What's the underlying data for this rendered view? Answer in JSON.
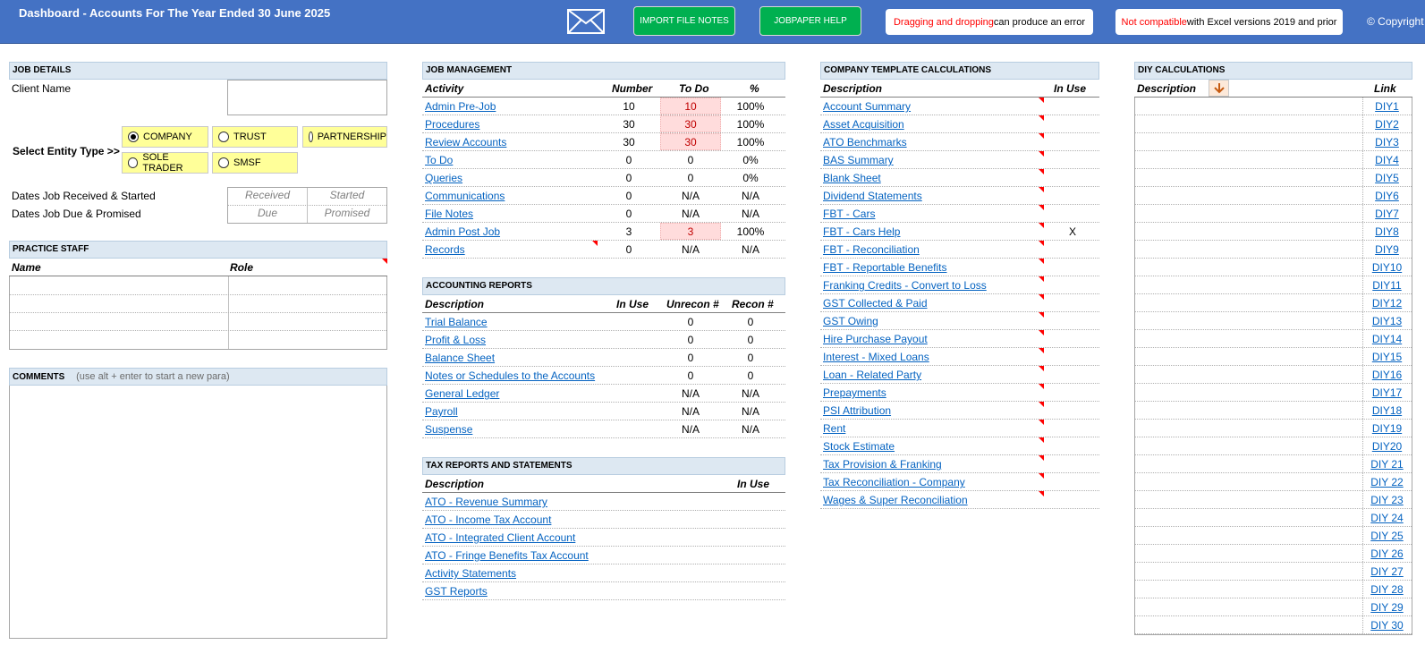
{
  "header": {
    "title": "Dashboard - Accounts For The Year Ended 30 June 2025",
    "import_button": "IMPORT FILE NOTES",
    "help_button": "JOBPAPER HELP",
    "notice1_red": "Dragging and dropping",
    "notice1_rest": " can produce an error",
    "notice2_red": "Not compatible",
    "notice2_rest": " with Excel versions 2019 and prior",
    "copyright": "© Copyright",
    "mail_icon": "envelope-icon"
  },
  "job_details": {
    "heading": "JOB DETAILS",
    "client_name_label": "Client Name",
    "client_name_value": "",
    "entity_label": "Select Entity Type >>",
    "entity_options": [
      "COMPANY",
      "TRUST",
      "PARTNERSHIP",
      "SOLE TRADER",
      "SMSF"
    ],
    "selected_entity": "COMPANY",
    "dates_received_label": "Dates Job Received & Started",
    "dates_due_label": "Dates Job Due & Promised",
    "received": "Received",
    "started": "Started",
    "due": "Due",
    "promised": "Promised"
  },
  "practice_staff": {
    "heading": "PRACTICE STAFF",
    "col_name": "Name",
    "col_role": "Role"
  },
  "comments": {
    "heading": "COMMENTS",
    "hint": "(use alt + enter to start a new para)",
    "value": ""
  },
  "job_management": {
    "heading": "JOB MANAGEMENT",
    "columns": [
      "Activity",
      "Number",
      "To Do",
      "%"
    ],
    "rows": [
      {
        "activity": "Admin Pre-Job",
        "number": "10",
        "todo": "10",
        "pct": "100%",
        "flag": true
      },
      {
        "activity": "Procedures",
        "number": "30",
        "todo": "30",
        "pct": "100%",
        "flag": true
      },
      {
        "activity": "Review Accounts",
        "number": "30",
        "todo": "30",
        "pct": "100%",
        "flag": true
      },
      {
        "activity": "To Do",
        "number": "0",
        "todo": "0",
        "pct": "0%",
        "flag": false
      },
      {
        "activity": "Queries",
        "number": "0",
        "todo": "0",
        "pct": "0%",
        "flag": false
      },
      {
        "activity": "Communications",
        "number": "0",
        "todo": "N/A",
        "pct": "N/A",
        "flag": false
      },
      {
        "activity": "File Notes",
        "number": "0",
        "todo": "N/A",
        "pct": "N/A",
        "flag": false
      },
      {
        "activity": "Admin Post Job",
        "number": "3",
        "todo": "3",
        "pct": "100%",
        "flag": true
      },
      {
        "activity": "Records",
        "number": "0",
        "todo": "N/A",
        "pct": "N/A",
        "flag": false
      }
    ]
  },
  "accounting_reports": {
    "heading": "ACCOUNTING REPORTS",
    "columns": [
      "Description",
      "In Use",
      "Unrecon #",
      "Recon #"
    ],
    "rows": [
      {
        "desc": "Trial Balance",
        "in_use": "",
        "unrecon": "0",
        "recon": "0"
      },
      {
        "desc": "Profit & Loss",
        "in_use": "",
        "unrecon": "0",
        "recon": "0"
      },
      {
        "desc": "Balance Sheet",
        "in_use": "",
        "unrecon": "0",
        "recon": "0"
      },
      {
        "desc": "Notes or Schedules to the Accounts",
        "in_use": "",
        "unrecon": "0",
        "recon": "0"
      },
      {
        "desc": "General Ledger",
        "in_use": "",
        "unrecon": "N/A",
        "recon": "N/A"
      },
      {
        "desc": "Payroll",
        "in_use": "",
        "unrecon": "N/A",
        "recon": "N/A"
      },
      {
        "desc": "Suspense",
        "in_use": "",
        "unrecon": "N/A",
        "recon": "N/A"
      }
    ]
  },
  "tax_reports": {
    "heading": "TAX REPORTS AND STATEMENTS",
    "columns": [
      "Description",
      "In Use"
    ],
    "rows": [
      {
        "desc": "ATO - Revenue Summary",
        "in_use": ""
      },
      {
        "desc": "ATO - Income Tax Account",
        "in_use": ""
      },
      {
        "desc": "ATO - Integrated Client Account",
        "in_use": ""
      },
      {
        "desc": "ATO - Fringe Benefits Tax Account",
        "in_use": ""
      },
      {
        "desc": "Activity Statements",
        "in_use": ""
      },
      {
        "desc": "GST Reports",
        "in_use": ""
      }
    ]
  },
  "company_template": {
    "heading": "COMPANY TEMPLATE CALCULATIONS",
    "columns": [
      "Description",
      "In Use"
    ],
    "rows": [
      {
        "desc": "Account Summary",
        "in_use": ""
      },
      {
        "desc": "Asset Acquisition",
        "in_use": ""
      },
      {
        "desc": "ATO Benchmarks",
        "in_use": ""
      },
      {
        "desc": "BAS Summary",
        "in_use": ""
      },
      {
        "desc": "Blank Sheet",
        "in_use": ""
      },
      {
        "desc": "Dividend Statements",
        "in_use": ""
      },
      {
        "desc": "FBT - Cars",
        "in_use": ""
      },
      {
        "desc": "FBT - Cars Help",
        "in_use": "X"
      },
      {
        "desc": "FBT - Reconciliation",
        "in_use": ""
      },
      {
        "desc": "FBT - Reportable Benefits",
        "in_use": ""
      },
      {
        "desc": "Franking Credits - Convert to Loss",
        "in_use": ""
      },
      {
        "desc": "GST Collected & Paid",
        "in_use": ""
      },
      {
        "desc": "GST Owing",
        "in_use": ""
      },
      {
        "desc": "Hire Purchase Payout",
        "in_use": ""
      },
      {
        "desc": "Interest - Mixed Loans",
        "in_use": ""
      },
      {
        "desc": "Loan - Related Party",
        "in_use": ""
      },
      {
        "desc": "Prepayments",
        "in_use": ""
      },
      {
        "desc": "PSI Attribution",
        "in_use": ""
      },
      {
        "desc": "Rent",
        "in_use": ""
      },
      {
        "desc": "Stock Estimate",
        "in_use": ""
      },
      {
        "desc": "Tax Provision & Franking",
        "in_use": ""
      },
      {
        "desc": "Tax Reconciliation - Company",
        "in_use": ""
      },
      {
        "desc": "Wages & Super Reconciliation",
        "in_use": ""
      }
    ]
  },
  "diy": {
    "heading": "DIY CALCULATIONS",
    "columns": [
      "Description",
      "Link"
    ],
    "sort_icon": "arrow-down-icon",
    "links": [
      "DIY1",
      "DIY2",
      "DIY3",
      "DIY4",
      "DIY5",
      "DIY6",
      "DIY7",
      "DIY8",
      "DIY9",
      "DIY10",
      "DIY11",
      "DIY12",
      "DIY13",
      "DIY14",
      "DIY15",
      "DIY16",
      "DIY17",
      "DIY18",
      "DIY19",
      "DIY20",
      "DIY 21",
      "DIY 22",
      "DIY 23",
      "DIY 24",
      "DIY 25",
      "DIY 26",
      "DIY 27",
      "DIY 28",
      "DIY 29",
      "DIY 30"
    ]
  }
}
